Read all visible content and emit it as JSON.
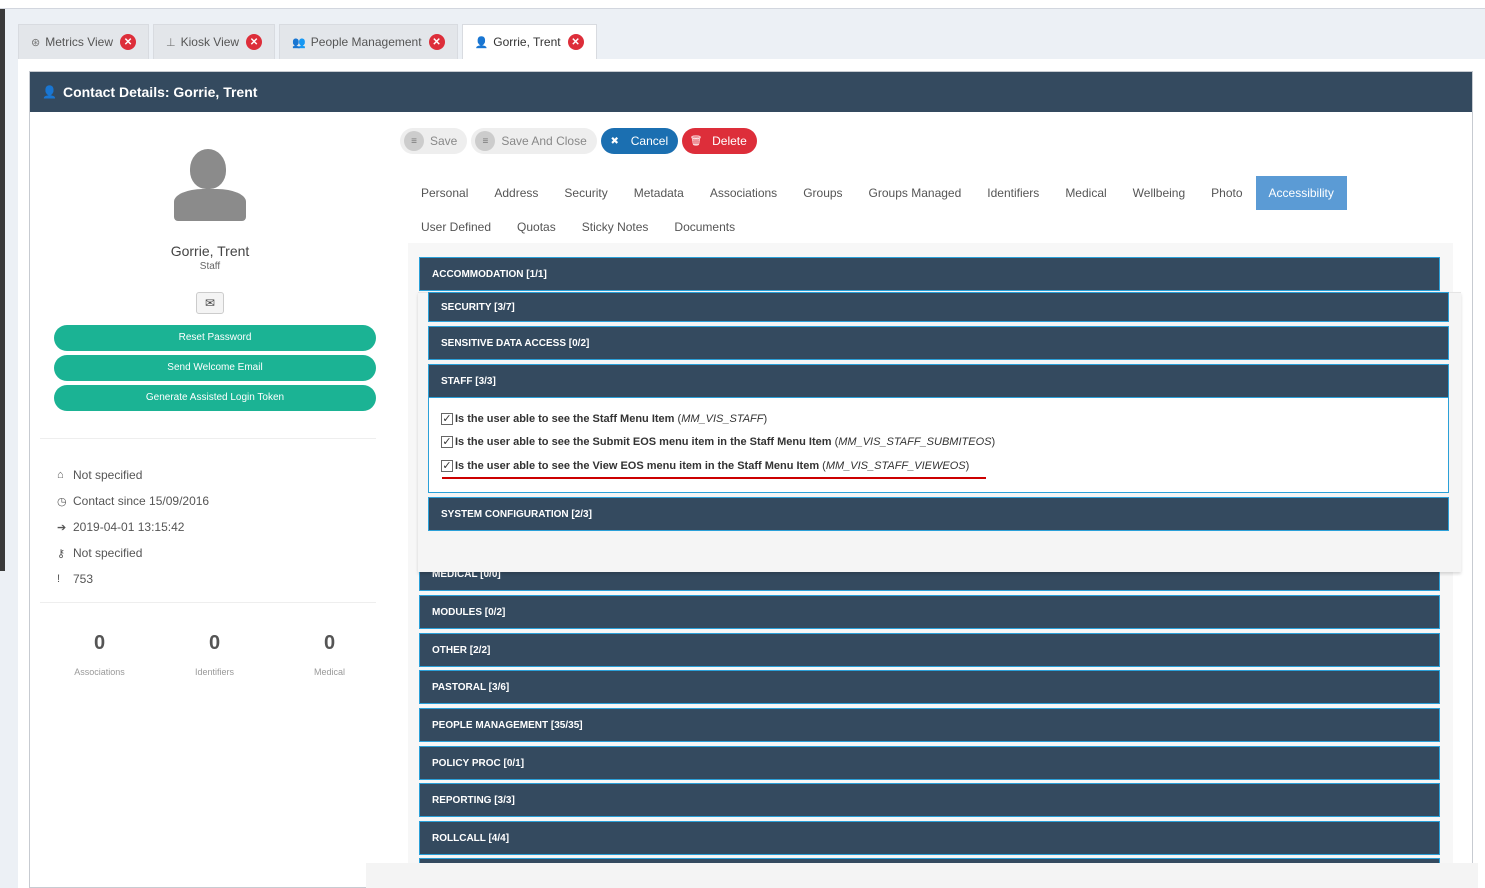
{
  "tabs": [
    {
      "icon": "gauge-icon",
      "glyph": "⊛",
      "label": "Metrics View"
    },
    {
      "icon": "pin-icon",
      "glyph": "⊥",
      "label": "Kiosk View"
    },
    {
      "icon": "users-icon",
      "glyph": "👥",
      "label": "People Management"
    },
    {
      "icon": "user-icon",
      "glyph": "👤",
      "label": "Gorrie, Trent",
      "active": true
    }
  ],
  "panel": {
    "title": "Contact Details: Gorrie, Trent"
  },
  "profile": {
    "name": "Gorrie, Trent",
    "role": "Staff",
    "buttons": [
      "Reset Password",
      "Send Welcome Email",
      "Generate Assisted Login Token"
    ],
    "info": [
      {
        "icon": "home-icon",
        "glyph": "⌂",
        "text": "Not specified"
      },
      {
        "icon": "clock-icon",
        "glyph": "◷",
        "text": "Contact since 15/09/2016"
      },
      {
        "icon": "sign-in-icon",
        "glyph": "➔",
        "text": "2019-04-01 13:15:42"
      },
      {
        "icon": "key-icon",
        "glyph": "⚷",
        "text": "Not specified"
      },
      {
        "icon": "exclamation-icon",
        "glyph": "!",
        "text": "753"
      }
    ],
    "stats": [
      {
        "value": "0",
        "label": "Associations"
      },
      {
        "value": "0",
        "label": "Identifiers"
      },
      {
        "value": "0",
        "label": "Medical"
      }
    ]
  },
  "toolbar": {
    "save": "Save",
    "save_close": "Save And Close",
    "cancel": "Cancel",
    "delete": "Delete"
  },
  "nav": {
    "row1": [
      "Personal",
      "Address",
      "Security",
      "Metadata",
      "Associations",
      "Groups",
      "Groups Managed",
      "Identifiers",
      "Medical",
      "Wellbeing",
      "Photo",
      "Accessibility"
    ],
    "row2": [
      "User Defined",
      "Quotas",
      "Sticky Notes",
      "Documents"
    ],
    "active": "Accessibility"
  },
  "sections": {
    "accommodation": "ACCOMMODATION [1/1]",
    "security": "SECURITY [3/7]",
    "sensitive": "SENSITIVE DATA ACCESS [0/2]",
    "staff": "STAFF [3/3]",
    "sysconfig": "SYSTEM CONFIGURATION [2/3]",
    "medical": "MEDICAL [0/0]",
    "modules": "MODULES [0/2]",
    "other": "OTHER [2/2]",
    "pastoral": "PASTORAL [3/6]",
    "people": "PEOPLE MANAGEMENT [35/35]",
    "policy": "POLICY PROC [0/1]",
    "reporting": "REPORTING [3/3]",
    "rollcall": "ROLLCALL [4/4]"
  },
  "staff_items": [
    {
      "label": "Is the user able to see the Staff Menu Item",
      "code": "MM_VIS_STAFF",
      "checked": true
    },
    {
      "label": "Is the user able to see the Submit EOS menu item in the Staff Menu Item",
      "code": "MM_VIS_STAFF_SUBMITEOS",
      "checked": true
    },
    {
      "label": "Is the user able to see the View EOS menu item in the Staff Menu Item",
      "code": "MM_VIS_STAFF_VIEWEOS",
      "checked": true
    }
  ],
  "colors": {
    "header": "#344a5f",
    "green": "#1bb394",
    "blue": "#1b6fb1",
    "red": "#dd2e3a",
    "active_tab": "#5b9bd5"
  }
}
